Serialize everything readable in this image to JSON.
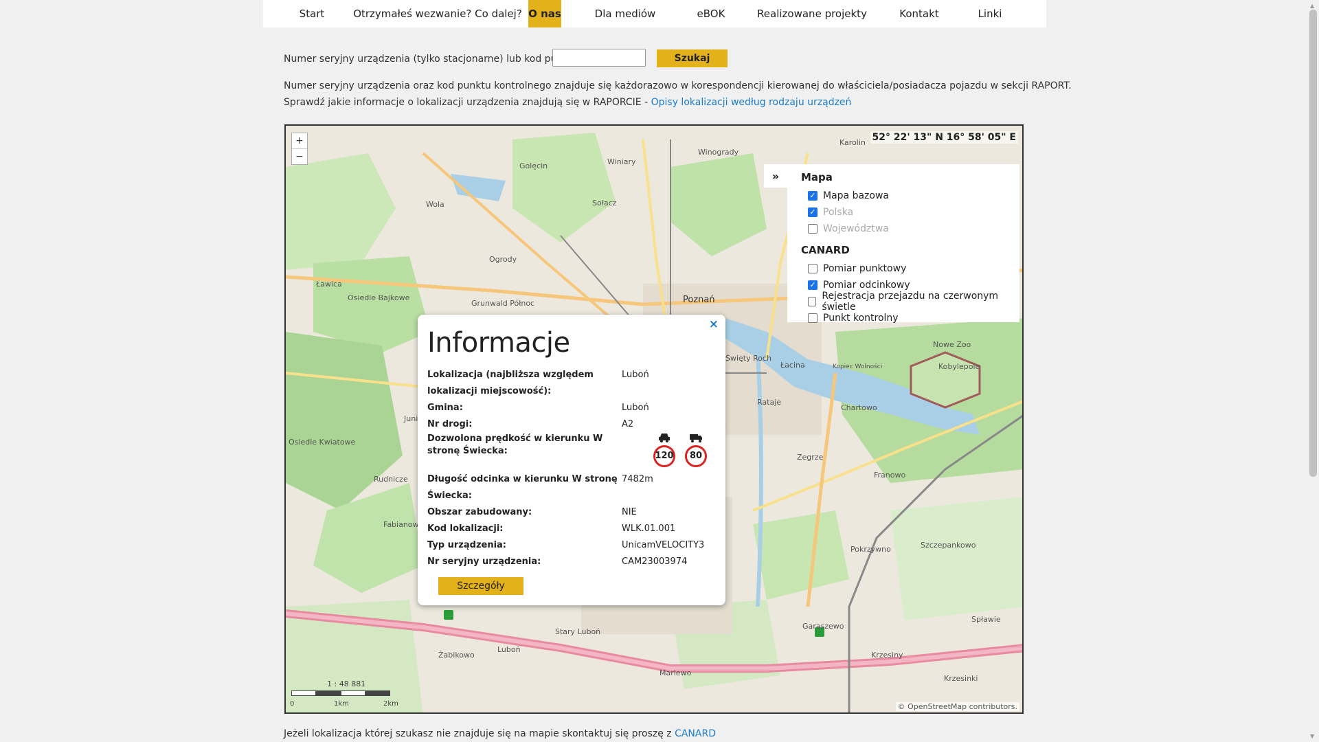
{
  "nav": {
    "items": [
      {
        "label": "Start"
      },
      {
        "label": "Otrzymałeś wezwanie? Co dalej?"
      },
      {
        "label": "O nas"
      },
      {
        "label": "Dla mediów"
      },
      {
        "label": "eBOK"
      },
      {
        "label": "Realizowane projekty"
      },
      {
        "label": "Kontakt"
      },
      {
        "label": "Linki"
      }
    ],
    "active_index": 2
  },
  "search": {
    "label": "Numer seryjny urządzenia (tylko stacjonarne) lub kod punktu:",
    "value": "",
    "button": "Szukaj"
  },
  "info": {
    "line1": "Numer seryjny urządzenia oraz kod punktu kontrolnego znajduje się każdorazowo w korespondencji kierowanej do właściciela/posiadacza pojazdu w sekcji RAPORT.",
    "line2_prefix": "Sprawdź jakie informacje o lokalizacji urządzenia znajdują się w RAPORCIE - ",
    "line2_link": "Opisy lokalizacji według rodzaju urządzeń"
  },
  "map": {
    "zoom_in": "+",
    "zoom_out": "−",
    "coords": "52° 22' 13\" N 16° 58' 05\" E",
    "layers_toggle": "»",
    "scale_text": "1 : 48 881",
    "scale_ticks": {
      "a": "0",
      "b": "1km",
      "c": "2km"
    },
    "attribution_a": "© OpenStreetMap",
    "attribution_b": " contributors.",
    "places": {
      "winiary": "Winiary",
      "golecin": "Golęcin",
      "solacz": "Sołacz",
      "wola": "Wola",
      "ogrody": "Ogrody",
      "lawica": "Ławica",
      "osiedle_bajkowe": "Osiedle Bajkowe",
      "grunwald": "Grunwald Północ",
      "poznan": "Poznań",
      "winogrady": "Winogrady",
      "karolin": "Karolin",
      "swiety_roch": "Święty Roch",
      "lacina": "Łacina",
      "kobylepole": "Kobylepole",
      "rataje": "Rataje",
      "chartowo": "Chartowo",
      "zegrze": "Zegrze",
      "franowo": "Franowo",
      "junikowo": "Junikowo",
      "osiedle_kwiatowe": "Osiedle Kwiatowe",
      "rudnicze": "Rudnicze",
      "fabianowo": "Fabianowo",
      "szczepankowo": "Szczepankowo",
      "pokrzywno": "Pokrzywno",
      "garaszewo": "Garaszewo",
      "splawie": "Spławie",
      "krzesiny": "Krzesiny",
      "krzesinki": "Krzesinki",
      "zabikowo": "Żabikowo",
      "lubon": "Luboń",
      "stary_lubon": "Stary Luboń",
      "marlewo": "Marlewo",
      "nowe_zoo": "Nowe Zoo",
      "kopiec": "Kopiec Wolności"
    }
  },
  "layers": {
    "mapa_head": "Mapa",
    "canard_head": "CANARD",
    "mapa": [
      {
        "label": "Mapa bazowa",
        "checked": true,
        "disabled": false
      },
      {
        "label": "Polska",
        "checked": true,
        "disabled": true
      },
      {
        "label": "Województwa",
        "checked": false,
        "disabled": true
      }
    ],
    "canard": [
      {
        "label": "Pomiar punktowy",
        "checked": false,
        "disabled": false
      },
      {
        "label": "Pomiar odcinkowy",
        "checked": true,
        "disabled": false
      },
      {
        "label": "Rejestracja przejazdu na czerwonym świetle",
        "checked": false,
        "disabled": false
      },
      {
        "label": "Punkt kontrolny",
        "checked": false,
        "disabled": false
      }
    ]
  },
  "popup": {
    "close": "×",
    "title": "Informacje",
    "location_key": "Lokalizacja (najbliższa względem lokalizacji miejscowość):",
    "location_val": "Luboń",
    "gmina_key": "Gmina:",
    "gmina_val": "Luboń",
    "road_key": "Nr drogi:",
    "road_val": "A2",
    "speed_key": "Dozwolona prędkość w kierunku W stronę Świecka:",
    "speed_car": "120",
    "speed_truck": "80",
    "length_key": "Długość odcinka w kierunku W stronę Świecka:",
    "length_val": "7482m",
    "built_key": "Obszar zabudowany:",
    "built_val": "NIE",
    "code_key": "Kod lokalizacji:",
    "code_val": "WLK.01.001",
    "type_key": "Typ urządzenia:",
    "type_val": "UnicamVELOCITY3",
    "serial_key": "Nr seryjny urządzenia:",
    "serial_val": "CAM23003974",
    "details_button": "Szczegóły"
  },
  "footer": {
    "prefix": "Jeżeli lokalizacja której szukasz nie znajduje się na mapie skontaktuj się proszę z ",
    "link": "CANARD"
  }
}
